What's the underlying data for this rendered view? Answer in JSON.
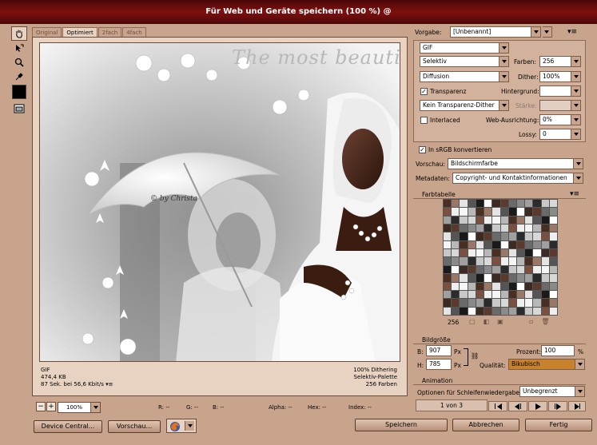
{
  "window": {
    "title": "Für Web und Geräte speichern (100 %) @"
  },
  "tabs": [
    "Original",
    "Optimiert",
    "2fach",
    "4fach"
  ],
  "preview": {
    "overlay_text": "The most beautiful Day",
    "credit": "© by Christa",
    "info_left": [
      "GIF",
      "474,4 KB",
      "87 Sek. bei 56,6 Kbit/s"
    ],
    "info_right": [
      "100% Dithering",
      "Selektiv-Palette",
      "256 Farben"
    ]
  },
  "statusbar": {
    "zoom": "100%",
    "r": "R: --",
    "g": "G: --",
    "b": "B: --",
    "alpha": "Alpha: --",
    "hex": "Hex: --",
    "index": "Index: --"
  },
  "settings": {
    "vorgabe_label": "Vorgabe:",
    "vorgabe_value": "[Unbenannt]",
    "format": "GIF",
    "reduction": "Selektiv",
    "farben_label": "Farben:",
    "farben_value": "256",
    "dither_algo": "Diffusion",
    "dither_label": "Dither:",
    "dither_value": "100%",
    "transparenz_label": "Transparenz",
    "hintergrund_label": "Hintergrund:",
    "transp_dither": "Kein Transparenz-Dither",
    "starke_label": "Stärke:",
    "interlaced_label": "Interlaced",
    "web_label": "Web-Ausrichtung:",
    "web_value": "0%",
    "lossy_label": "Lossy:",
    "lossy_value": "0",
    "srgb_label": "In sRGB konvertieren",
    "vorschau_label": "Vorschau:",
    "vorschau_value": "Bildschirmfarbe",
    "metadaten_label": "Metadaten:",
    "metadaten_value": "Copyright- und Kontaktinformationen"
  },
  "farbtabelle": {
    "title": "Farbtabelle",
    "count": "256"
  },
  "bildgroesse": {
    "title": "Bildgröße",
    "b_label": "B:",
    "b_value": "907",
    "h_label": "H:",
    "h_value": "785",
    "unit": "Px",
    "prozent_label": "Prozent:",
    "prozent_value": "100",
    "prozent_unit": "%",
    "qualitat_label": "Qualität:",
    "qualitat_value": "Bikubisch"
  },
  "animation": {
    "title": "Animation",
    "loop_label": "Optionen für Schleifenwiedergabe:",
    "loop_value": "Unbegrenzt",
    "frame": "1 von 3"
  },
  "buttons": {
    "device_central": "Device Central...",
    "vorschau": "Vorschau...",
    "speichern": "Speichern",
    "abbrechen": "Abbrechen",
    "fertig": "Fertig"
  },
  "colors": {
    "accent": "#800f0f",
    "chrome": "#c8a48c",
    "highlight": "#e8d2c2",
    "quality_field": "#c8822e"
  },
  "icons": [
    "hand-icon",
    "slice-select-icon",
    "zoom-icon",
    "eyedropper-icon",
    "color-swatch-icon",
    "toggle-slices-icon",
    "browser-firefox-icon",
    "panel-menu-icon"
  ]
}
